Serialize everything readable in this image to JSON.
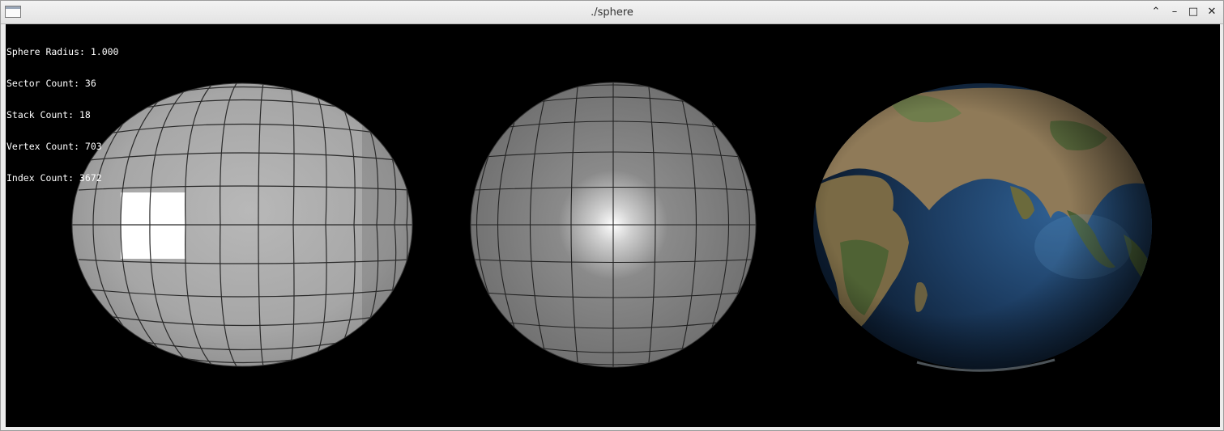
{
  "window": {
    "title": "./sphere"
  },
  "info": {
    "radius": "Sphere Radius: 1.000",
    "sectors": "Sector Count: 36",
    "stacks": "Stack Count: 18",
    "vertices": "Vertex Count: 703",
    "indices": "Index Count: 3672"
  },
  "controls": {
    "shade_icon": "shade-icon",
    "minimize_icon": "minimize-icon",
    "maximize_icon": "maximize-icon",
    "close_icon": "close-icon"
  }
}
